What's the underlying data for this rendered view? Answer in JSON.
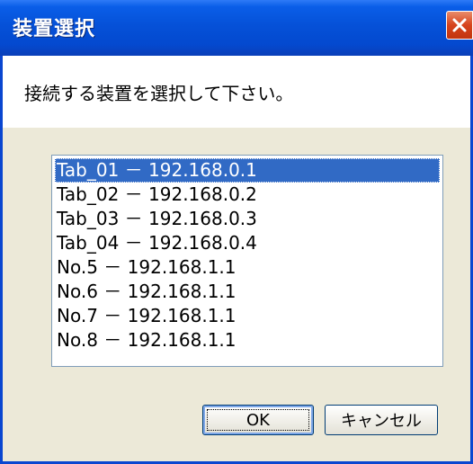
{
  "window": {
    "title": "装置選択",
    "instruction": "接続する装置を選択して下さい。"
  },
  "devices": [
    "Tab_01 － 192.168.0.1",
    "Tab_02 － 192.168.0.2",
    "Tab_03 － 192.168.0.3",
    "Tab_04 － 192.168.0.4",
    "No.5 － 192.168.1.1",
    "No.6 － 192.168.1.1",
    "No.7 － 192.168.1.1",
    "No.8 － 192.168.1.1"
  ],
  "selected_index": 0,
  "buttons": {
    "ok_label": "OK",
    "cancel_label": "キャンセル"
  },
  "colors": {
    "titlebar": "#0551d8",
    "selection": "#316ac5",
    "close": "#d6431c"
  }
}
